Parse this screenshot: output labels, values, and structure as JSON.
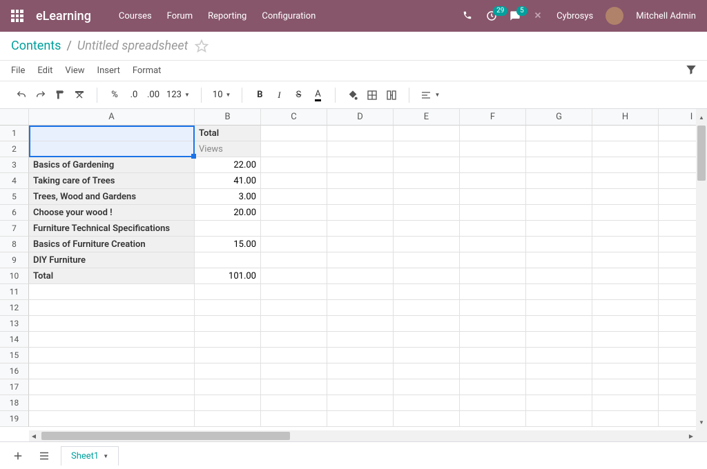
{
  "nav": {
    "brand": "eLearning",
    "links": [
      "Courses",
      "Forum",
      "Reporting",
      "Configuration"
    ],
    "badge1": "29",
    "badge2": "5",
    "company": "Cybrosys",
    "user": "Mitchell Admin"
  },
  "crumb": {
    "root": "Contents",
    "title": "Untitled spreadsheet"
  },
  "menus": [
    "File",
    "Edit",
    "View",
    "Insert",
    "Format"
  ],
  "toolbar": {
    "pct": "%",
    "dec_dec": ".0",
    "inc_dec": ".00",
    "numfmt": "123",
    "fontsize": "10",
    "bold": "B",
    "italic": "I",
    "strike": "S",
    "textcolor": "A"
  },
  "sheet": {
    "cols": [
      "A",
      "B",
      "C",
      "D",
      "E",
      "F",
      "G",
      "H",
      "I"
    ],
    "rows": 19,
    "cells": {
      "1": {
        "B": "Total"
      },
      "2": {
        "B": "Views"
      },
      "3": {
        "A": "Basics of Gardening",
        "B": "22.00"
      },
      "4": {
        "A": "Taking care of Trees",
        "B": "41.00"
      },
      "5": {
        "A": "Trees, Wood and Gardens",
        "B": "3.00"
      },
      "6": {
        "A": "Choose your wood !",
        "B": "20.00"
      },
      "7": {
        "A": "Furniture Technical Specifications"
      },
      "8": {
        "A": "Basics of Furniture Creation",
        "B": "15.00"
      },
      "9": {
        "A": "DIY Furniture"
      },
      "10": {
        "A": "Total",
        "B": "101.00"
      }
    },
    "selection": {
      "from": [
        1,
        "A"
      ],
      "to": [
        2,
        "A"
      ]
    }
  },
  "tabs": {
    "name": "Sheet1"
  }
}
